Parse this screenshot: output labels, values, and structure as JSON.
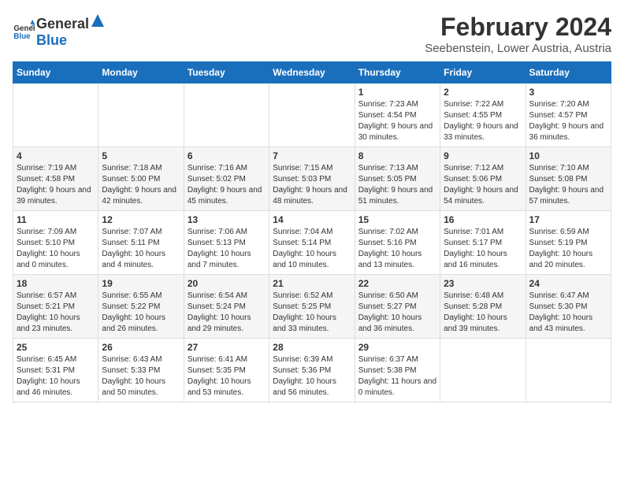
{
  "logo": {
    "text_general": "General",
    "text_blue": "Blue"
  },
  "title": "February 2024",
  "subtitle": "Seebenstein, Lower Austria, Austria",
  "headers": [
    "Sunday",
    "Monday",
    "Tuesday",
    "Wednesday",
    "Thursday",
    "Friday",
    "Saturday"
  ],
  "weeks": [
    [
      {
        "day": "",
        "info": ""
      },
      {
        "day": "",
        "info": ""
      },
      {
        "day": "",
        "info": ""
      },
      {
        "day": "",
        "info": ""
      },
      {
        "day": "1",
        "info": "Sunrise: 7:23 AM\nSunset: 4:54 PM\nDaylight: 9 hours and 30 minutes."
      },
      {
        "day": "2",
        "info": "Sunrise: 7:22 AM\nSunset: 4:55 PM\nDaylight: 9 hours and 33 minutes."
      },
      {
        "day": "3",
        "info": "Sunrise: 7:20 AM\nSunset: 4:57 PM\nDaylight: 9 hours and 36 minutes."
      }
    ],
    [
      {
        "day": "4",
        "info": "Sunrise: 7:19 AM\nSunset: 4:58 PM\nDaylight: 9 hours and 39 minutes."
      },
      {
        "day": "5",
        "info": "Sunrise: 7:18 AM\nSunset: 5:00 PM\nDaylight: 9 hours and 42 minutes."
      },
      {
        "day": "6",
        "info": "Sunrise: 7:16 AM\nSunset: 5:02 PM\nDaylight: 9 hours and 45 minutes."
      },
      {
        "day": "7",
        "info": "Sunrise: 7:15 AM\nSunset: 5:03 PM\nDaylight: 9 hours and 48 minutes."
      },
      {
        "day": "8",
        "info": "Sunrise: 7:13 AM\nSunset: 5:05 PM\nDaylight: 9 hours and 51 minutes."
      },
      {
        "day": "9",
        "info": "Sunrise: 7:12 AM\nSunset: 5:06 PM\nDaylight: 9 hours and 54 minutes."
      },
      {
        "day": "10",
        "info": "Sunrise: 7:10 AM\nSunset: 5:08 PM\nDaylight: 9 hours and 57 minutes."
      }
    ],
    [
      {
        "day": "11",
        "info": "Sunrise: 7:09 AM\nSunset: 5:10 PM\nDaylight: 10 hours and 0 minutes."
      },
      {
        "day": "12",
        "info": "Sunrise: 7:07 AM\nSunset: 5:11 PM\nDaylight: 10 hours and 4 minutes."
      },
      {
        "day": "13",
        "info": "Sunrise: 7:06 AM\nSunset: 5:13 PM\nDaylight: 10 hours and 7 minutes."
      },
      {
        "day": "14",
        "info": "Sunrise: 7:04 AM\nSunset: 5:14 PM\nDaylight: 10 hours and 10 minutes."
      },
      {
        "day": "15",
        "info": "Sunrise: 7:02 AM\nSunset: 5:16 PM\nDaylight: 10 hours and 13 minutes."
      },
      {
        "day": "16",
        "info": "Sunrise: 7:01 AM\nSunset: 5:17 PM\nDaylight: 10 hours and 16 minutes."
      },
      {
        "day": "17",
        "info": "Sunrise: 6:59 AM\nSunset: 5:19 PM\nDaylight: 10 hours and 20 minutes."
      }
    ],
    [
      {
        "day": "18",
        "info": "Sunrise: 6:57 AM\nSunset: 5:21 PM\nDaylight: 10 hours and 23 minutes."
      },
      {
        "day": "19",
        "info": "Sunrise: 6:55 AM\nSunset: 5:22 PM\nDaylight: 10 hours and 26 minutes."
      },
      {
        "day": "20",
        "info": "Sunrise: 6:54 AM\nSunset: 5:24 PM\nDaylight: 10 hours and 29 minutes."
      },
      {
        "day": "21",
        "info": "Sunrise: 6:52 AM\nSunset: 5:25 PM\nDaylight: 10 hours and 33 minutes."
      },
      {
        "day": "22",
        "info": "Sunrise: 6:50 AM\nSunset: 5:27 PM\nDaylight: 10 hours and 36 minutes."
      },
      {
        "day": "23",
        "info": "Sunrise: 6:48 AM\nSunset: 5:28 PM\nDaylight: 10 hours and 39 minutes."
      },
      {
        "day": "24",
        "info": "Sunrise: 6:47 AM\nSunset: 5:30 PM\nDaylight: 10 hours and 43 minutes."
      }
    ],
    [
      {
        "day": "25",
        "info": "Sunrise: 6:45 AM\nSunset: 5:31 PM\nDaylight: 10 hours and 46 minutes."
      },
      {
        "day": "26",
        "info": "Sunrise: 6:43 AM\nSunset: 5:33 PM\nDaylight: 10 hours and 50 minutes."
      },
      {
        "day": "27",
        "info": "Sunrise: 6:41 AM\nSunset: 5:35 PM\nDaylight: 10 hours and 53 minutes."
      },
      {
        "day": "28",
        "info": "Sunrise: 6:39 AM\nSunset: 5:36 PM\nDaylight: 10 hours and 56 minutes."
      },
      {
        "day": "29",
        "info": "Sunrise: 6:37 AM\nSunset: 5:38 PM\nDaylight: 11 hours and 0 minutes."
      },
      {
        "day": "",
        "info": ""
      },
      {
        "day": "",
        "info": ""
      }
    ]
  ]
}
